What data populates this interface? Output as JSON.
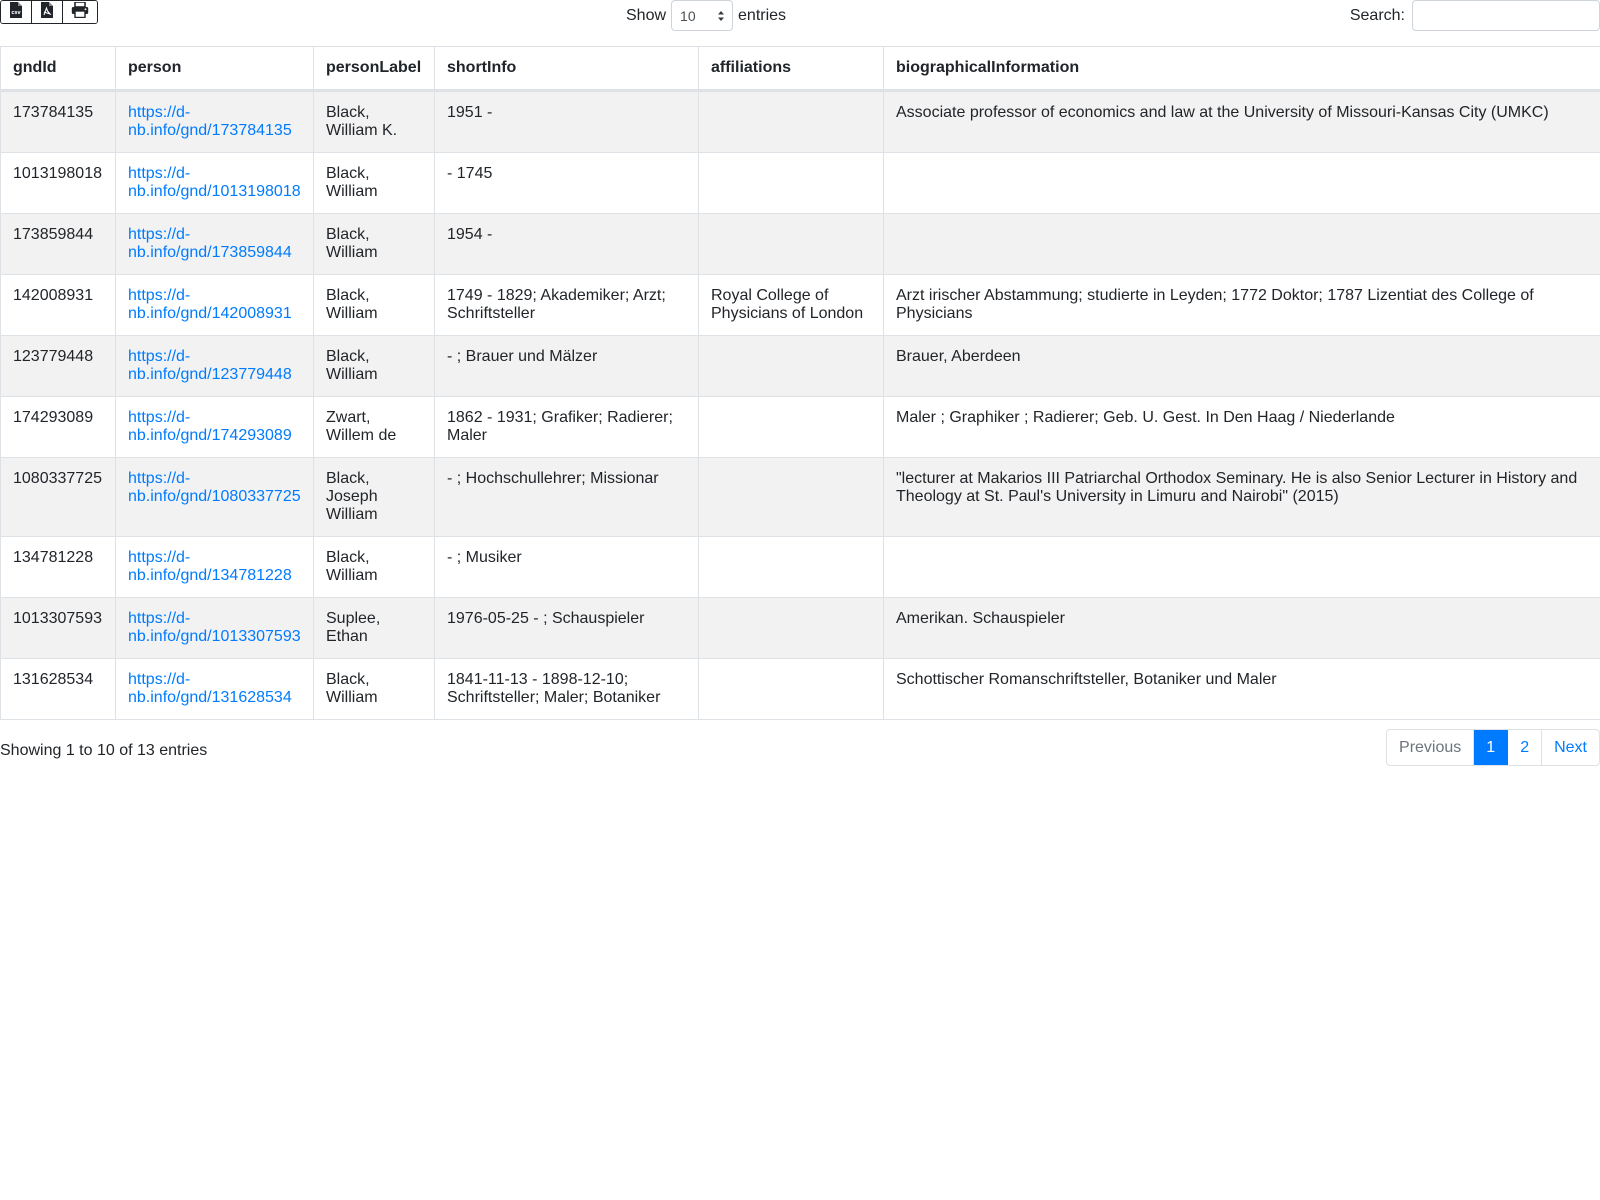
{
  "toolbar": {
    "export_buttons": [
      {
        "icon": "csv-file-icon"
      },
      {
        "icon": "pdf-file-icon"
      },
      {
        "icon": "print-icon"
      }
    ],
    "show_label": "Show",
    "length_value": "10",
    "entries_label": "entries",
    "search_label": "Search:",
    "search_value": ""
  },
  "table": {
    "columns": [
      "gndId",
      "person",
      "personLabel",
      "shortInfo",
      "affiliations",
      "biographicalInformation"
    ],
    "rows": [
      {
        "gndId": "173784135",
        "person": "https://d-nb.info/gnd/173784135",
        "personLabel": "Black, William K.",
        "shortInfo": "1951 -",
        "affiliations": "",
        "biographicalInformation": "Associate professor of economics and law at the University of Missouri-Kansas City (UMKC)"
      },
      {
        "gndId": "1013198018",
        "person": "https://d-nb.info/gnd/1013198018",
        "personLabel": "Black, William",
        "shortInfo": "- 1745",
        "affiliations": "",
        "biographicalInformation": ""
      },
      {
        "gndId": "173859844",
        "person": "https://d-nb.info/gnd/173859844",
        "personLabel": "Black, William",
        "shortInfo": "1954 -",
        "affiliations": "",
        "biographicalInformation": ""
      },
      {
        "gndId": "142008931",
        "person": "https://d-nb.info/gnd/142008931",
        "personLabel": "Black, William",
        "shortInfo": "1749 - 1829; Akademiker; Arzt; Schriftsteller",
        "affiliations": "Royal College of Physicians of London",
        "biographicalInformation": "Arzt irischer Abstammung; studierte in Leyden; 1772 Doktor; 1787 Lizentiat des College of Physicians"
      },
      {
        "gndId": "123779448",
        "person": "https://d-nb.info/gnd/123779448",
        "personLabel": "Black, William",
        "shortInfo": "- ; Brauer und Mälzer",
        "affiliations": "",
        "biographicalInformation": "Brauer, Aberdeen"
      },
      {
        "gndId": "174293089",
        "person": "https://d-nb.info/gnd/174293089",
        "personLabel": "Zwart, Willem de",
        "shortInfo": "1862 - 1931; Grafiker; Radierer; Maler",
        "affiliations": "",
        "biographicalInformation": "Maler ; Graphiker ; Radierer; Geb. U. Gest. In Den Haag / Niederlande"
      },
      {
        "gndId": "1080337725",
        "person": "https://d-nb.info/gnd/1080337725",
        "personLabel": "Black, Joseph William",
        "shortInfo": "- ; Hochschullehrer; Missionar",
        "affiliations": "",
        "biographicalInformation": "\"lecturer at Makarios III Patriarchal Orthodox Seminary. He is also Senior Lecturer in History and Theology at St. Paul's University in Limuru and Nairobi\" (2015)"
      },
      {
        "gndId": "134781228",
        "person": "https://d-nb.info/gnd/134781228",
        "personLabel": "Black, William",
        "shortInfo": "- ; Musiker",
        "affiliations": "",
        "biographicalInformation": ""
      },
      {
        "gndId": "1013307593",
        "person": "https://d-nb.info/gnd/1013307593",
        "personLabel": "Suplee, Ethan",
        "shortInfo": "1976-05-25 - ; Schauspieler",
        "affiliations": "",
        "biographicalInformation": "Amerikan. Schauspieler"
      },
      {
        "gndId": "131628534",
        "person": "https://d-nb.info/gnd/131628534",
        "personLabel": "Black, William",
        "shortInfo": "1841-11-13 - 1898-12-10; Schriftsteller; Maler; Botaniker",
        "affiliations": "",
        "biographicalInformation": "Schottischer Romanschriftsteller, Botaniker und Maler"
      }
    ]
  },
  "footer": {
    "info": "Showing 1 to 10 of 13 entries",
    "pagination": {
      "previous": "Previous",
      "pages": [
        "1",
        "2"
      ],
      "active_page": "1",
      "next": "Next"
    }
  },
  "colors": {
    "link": "#007bff",
    "active_page_bg": "#007bff",
    "row_striped": "#f2f2f2",
    "border": "#dee2e6"
  }
}
